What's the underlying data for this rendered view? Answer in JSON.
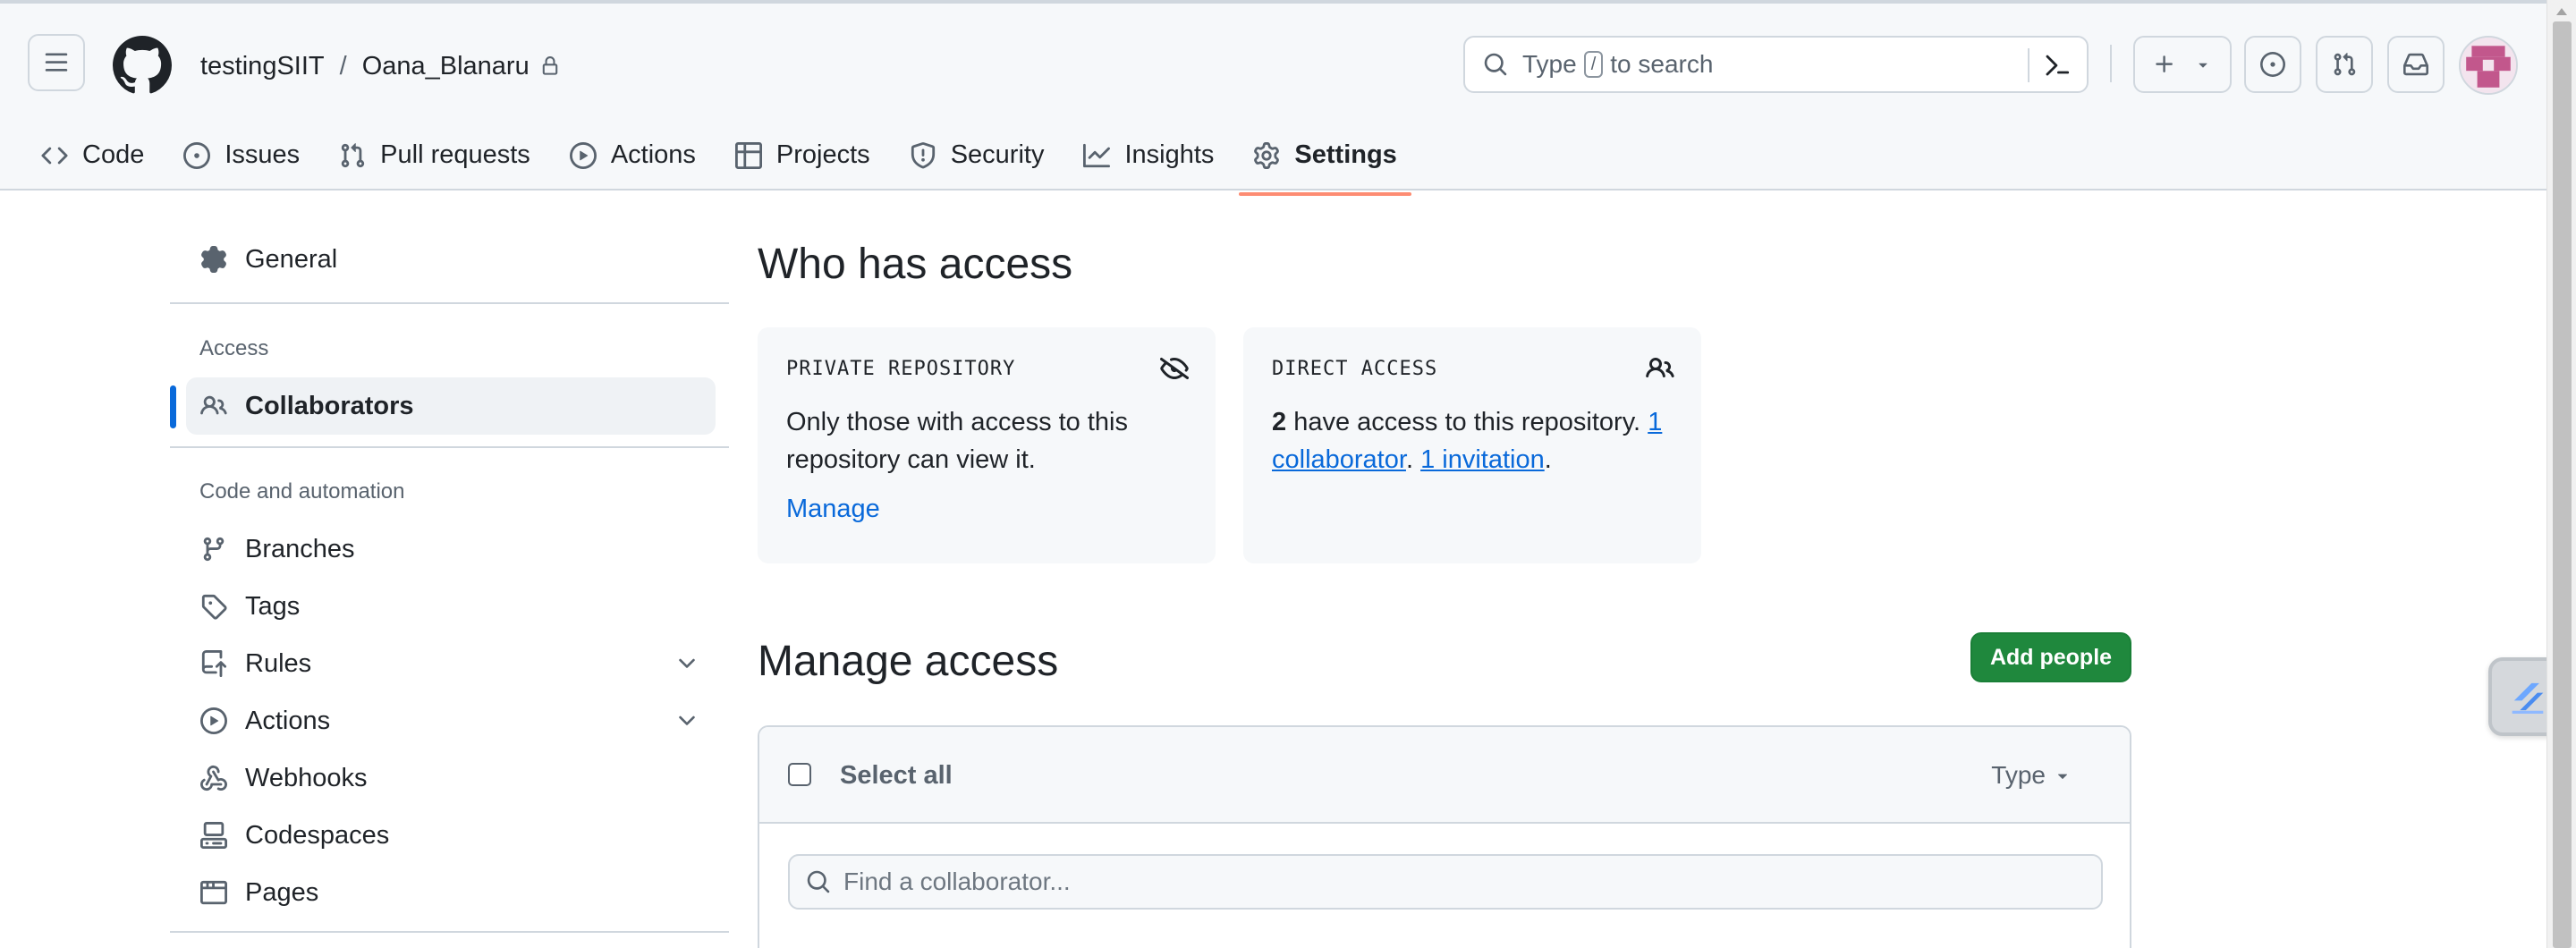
{
  "header": {
    "owner": "testingSIIT",
    "separator": "/",
    "repo": "Oana_Blanaru",
    "search": {
      "prefix": "Type",
      "key": "/",
      "suffix": "to search"
    }
  },
  "repo_nav": {
    "tabs": [
      {
        "label": "Code",
        "icon": "code-icon"
      },
      {
        "label": "Issues",
        "icon": "issue-opened-icon"
      },
      {
        "label": "Pull requests",
        "icon": "git-pull-request-icon"
      },
      {
        "label": "Actions",
        "icon": "play-icon"
      },
      {
        "label": "Projects",
        "icon": "table-icon"
      },
      {
        "label": "Security",
        "icon": "shield-icon"
      },
      {
        "label": "Insights",
        "icon": "graph-icon"
      },
      {
        "label": "Settings",
        "icon": "gear-icon",
        "active": true
      }
    ]
  },
  "sidebar": {
    "general": "General",
    "access_heading": "Access",
    "collaborators": "Collaborators",
    "code_heading": "Code and automation",
    "items": [
      {
        "label": "Branches",
        "icon": "git-branch-icon"
      },
      {
        "label": "Tags",
        "icon": "tag-icon"
      },
      {
        "label": "Rules",
        "icon": "repo-push-icon",
        "expandable": true
      },
      {
        "label": "Actions",
        "icon": "play-icon",
        "expandable": true
      },
      {
        "label": "Webhooks",
        "icon": "webhook-icon"
      },
      {
        "label": "Codespaces",
        "icon": "codespaces-icon"
      },
      {
        "label": "Pages",
        "icon": "browser-icon"
      }
    ]
  },
  "main": {
    "who_title": "Who has access",
    "private_card": {
      "label": "PRIVATE REPOSITORY",
      "text": "Only those with access to this repository can view it.",
      "link": "Manage"
    },
    "direct_card": {
      "label": "DIRECT ACCESS",
      "count": "2",
      "text_after_count": " have access to this repository. ",
      "collaborator_link": "1 collaborator",
      "separator": ". ",
      "invitation_link": "1 invitation",
      "end": "."
    },
    "manage_title": "Manage access",
    "add_people": "Add people",
    "select_all": "Select all",
    "type_filter": "Type",
    "find_placeholder": "Find a collaborator..."
  },
  "colors": {
    "accent_blue": "#0969da",
    "primary_green": "#1f883d",
    "tab_underline": "#fd8c73"
  }
}
